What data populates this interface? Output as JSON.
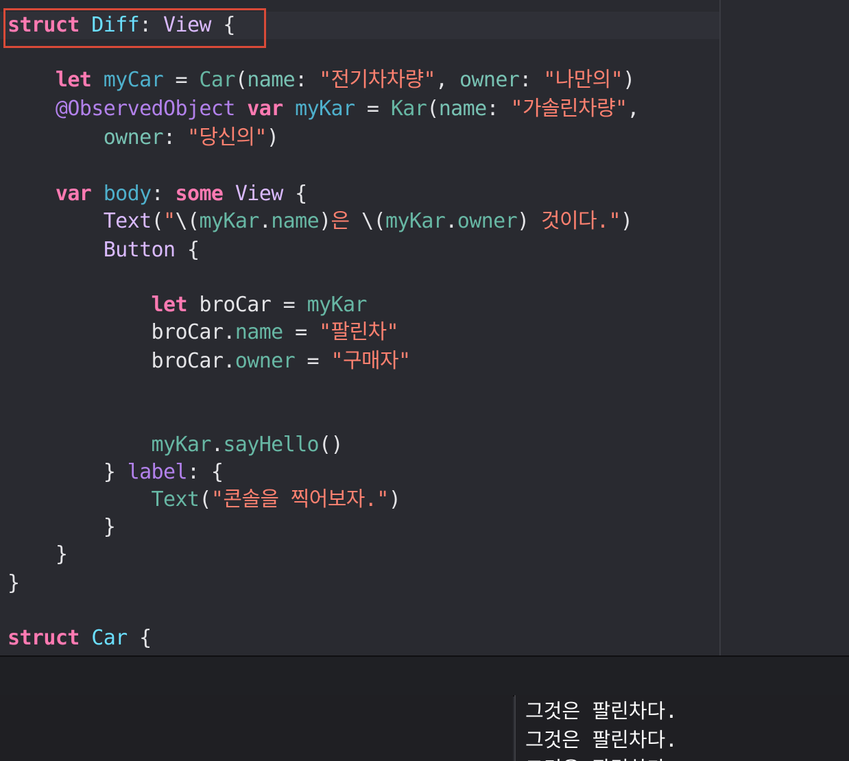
{
  "editor": {
    "lines": [
      {
        "segments": [
          {
            "cls": "kw",
            "text": "struct"
          },
          {
            "cls": "plain",
            "text": " "
          },
          {
            "cls": "decl",
            "text": "Diff"
          },
          {
            "cls": "plain",
            "text": ": "
          },
          {
            "cls": "typ",
            "text": "View"
          },
          {
            "cls": "plain",
            "text": " {"
          }
        ]
      },
      {
        "segments": [
          {
            "cls": "plain",
            "text": "    "
          },
          {
            "cls": "kw",
            "text": "let"
          },
          {
            "cls": "plain",
            "text": " "
          },
          {
            "cls": "ident",
            "text": "myCar"
          },
          {
            "cls": "plain",
            "text": " = "
          },
          {
            "cls": "teal2",
            "text": "Car"
          },
          {
            "cls": "plain",
            "text": "("
          },
          {
            "cls": "prop",
            "text": "name"
          },
          {
            "cls": "plain",
            "text": ": "
          },
          {
            "cls": "str",
            "text": "\"전기차차량\""
          },
          {
            "cls": "plain",
            "text": ", "
          },
          {
            "cls": "prop",
            "text": "owner"
          },
          {
            "cls": "plain",
            "text": ": "
          },
          {
            "cls": "str",
            "text": "\"나만의\""
          },
          {
            "cls": "plain",
            "text": ")"
          }
        ]
      },
      {
        "segments": [
          {
            "cls": "plain",
            "text": "    "
          },
          {
            "cls": "purple",
            "text": "@ObservedObject"
          },
          {
            "cls": "plain",
            "text": " "
          },
          {
            "cls": "kw",
            "text": "var"
          },
          {
            "cls": "plain",
            "text": " "
          },
          {
            "cls": "ident",
            "text": "myKar"
          },
          {
            "cls": "plain",
            "text": " = "
          },
          {
            "cls": "teal2",
            "text": "Kar"
          },
          {
            "cls": "plain",
            "text": "("
          },
          {
            "cls": "prop",
            "text": "name"
          },
          {
            "cls": "plain",
            "text": ": "
          },
          {
            "cls": "str",
            "text": "\"가솔린차량\""
          },
          {
            "cls": "plain",
            "text": ","
          }
        ]
      },
      {
        "segments": [
          {
            "cls": "plain",
            "text": "        "
          },
          {
            "cls": "prop",
            "text": "owner"
          },
          {
            "cls": "plain",
            "text": ": "
          },
          {
            "cls": "str",
            "text": "\"당신의\""
          },
          {
            "cls": "plain",
            "text": ")"
          }
        ]
      },
      {
        "segments": [
          {
            "cls": "plain",
            "text": "    "
          },
          {
            "cls": "kw",
            "text": "var"
          },
          {
            "cls": "plain",
            "text": " "
          },
          {
            "cls": "ident",
            "text": "body"
          },
          {
            "cls": "plain",
            "text": ": "
          },
          {
            "cls": "kw",
            "text": "some"
          },
          {
            "cls": "plain",
            "text": " "
          },
          {
            "cls": "typ",
            "text": "View"
          },
          {
            "cls": "plain",
            "text": " {"
          }
        ]
      },
      {
        "segments": [
          {
            "cls": "plain",
            "text": "        "
          },
          {
            "cls": "typ",
            "text": "Text"
          },
          {
            "cls": "plain",
            "text": "("
          },
          {
            "cls": "str",
            "text": "\""
          },
          {
            "cls": "plain",
            "text": "\\("
          },
          {
            "cls": "teal2",
            "text": "myKar"
          },
          {
            "cls": "plain",
            "text": "."
          },
          {
            "cls": "teal2",
            "text": "name"
          },
          {
            "cls": "plain",
            "text": ")"
          },
          {
            "cls": "str",
            "text": "은 "
          },
          {
            "cls": "plain",
            "text": "\\("
          },
          {
            "cls": "teal2",
            "text": "myKar"
          },
          {
            "cls": "plain",
            "text": "."
          },
          {
            "cls": "teal2",
            "text": "owner"
          },
          {
            "cls": "plain",
            "text": ") "
          },
          {
            "cls": "str",
            "text": "것이다.\""
          },
          {
            "cls": "plain",
            "text": ")"
          }
        ]
      },
      {
        "segments": [
          {
            "cls": "plain",
            "text": "        "
          },
          {
            "cls": "typ",
            "text": "Button"
          },
          {
            "cls": "plain",
            "text": " {"
          }
        ]
      },
      {
        "segments": [
          {
            "cls": "plain",
            "text": "            "
          },
          {
            "cls": "kw",
            "text": "let"
          },
          {
            "cls": "plain",
            "text": " broCar = "
          },
          {
            "cls": "teal2",
            "text": "myKar"
          }
        ]
      },
      {
        "segments": [
          {
            "cls": "plain",
            "text": "            broCar."
          },
          {
            "cls": "teal2",
            "text": "name"
          },
          {
            "cls": "plain",
            "text": " = "
          },
          {
            "cls": "str",
            "text": "\"팔린차\""
          }
        ]
      },
      {
        "segments": [
          {
            "cls": "plain",
            "text": "            broCar."
          },
          {
            "cls": "teal2",
            "text": "owner"
          },
          {
            "cls": "plain",
            "text": " = "
          },
          {
            "cls": "str",
            "text": "\"구매자\""
          }
        ]
      },
      {
        "segments": [
          {
            "cls": "plain",
            "text": "            "
          },
          {
            "cls": "teal2",
            "text": "myKar"
          },
          {
            "cls": "plain",
            "text": "."
          },
          {
            "cls": "teal2",
            "text": "sayHello"
          },
          {
            "cls": "plain",
            "text": "()"
          }
        ]
      },
      {
        "segments": [
          {
            "cls": "plain",
            "text": "        } "
          },
          {
            "cls": "purple",
            "text": "label"
          },
          {
            "cls": "plain",
            "text": ": {"
          }
        ]
      },
      {
        "segments": [
          {
            "cls": "plain",
            "text": "            "
          },
          {
            "cls": "teal2",
            "text": "Text"
          },
          {
            "cls": "plain",
            "text": "("
          },
          {
            "cls": "str",
            "text": "\"콘솔을 찍어보자.\""
          },
          {
            "cls": "plain",
            "text": ")"
          }
        ]
      },
      {
        "segments": [
          {
            "cls": "plain",
            "text": "        }"
          }
        ]
      },
      {
        "segments": [
          {
            "cls": "plain",
            "text": "    }"
          }
        ]
      },
      {
        "segments": [
          {
            "cls": "plain",
            "text": "}"
          }
        ]
      },
      {
        "segments": [
          {
            "cls": "kw",
            "text": "struct"
          },
          {
            "cls": "plain",
            "text": " "
          },
          {
            "cls": "decl",
            "text": "Car"
          },
          {
            "cls": "plain",
            "text": " {"
          }
        ]
      }
    ]
  },
  "console": {
    "lines": [
      "그것은 팔린차다.",
      "그것은 팔린차다.",
      "그것은 팔린차다."
    ]
  },
  "colors": {
    "background": "#292a30",
    "highlight_border": "#d94a38",
    "keyword": "#ff7ab2",
    "string": "#ff8170",
    "type": "#dabaff"
  }
}
